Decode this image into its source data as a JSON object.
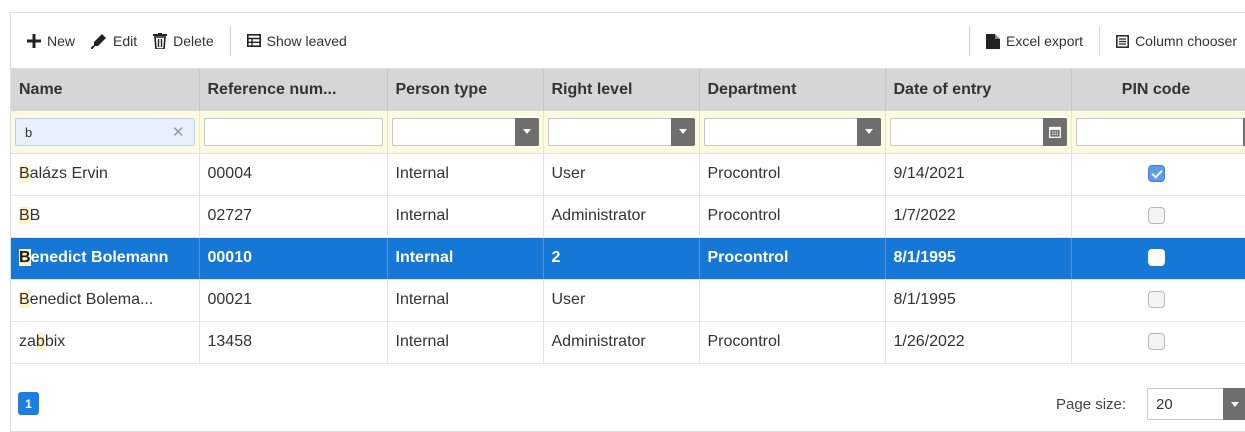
{
  "toolbar": {
    "new_label": "New",
    "edit_label": "Edit",
    "delete_label": "Delete",
    "show_leaved_label": "Show leaved",
    "excel_export_label": "Excel export",
    "column_chooser_label": "Column chooser"
  },
  "columns": [
    "Name",
    "Reference num...",
    "Person type",
    "Right level",
    "Department",
    "Date of entry",
    "PIN code"
  ],
  "filter": {
    "name_value": "b"
  },
  "rows": [
    {
      "name_pre": "",
      "name_hl": "B",
      "name_post": "alázs Ervin",
      "ref": "00004",
      "type": "Internal",
      "level": "User",
      "dept": "Procontrol",
      "date": "9/14/2021",
      "pin": true
    },
    {
      "name_pre": "",
      "name_hl": "B",
      "name_post": "B",
      "ref": "02727",
      "type": "Internal",
      "level": "Administrator",
      "dept": "Procontrol",
      "date": "1/7/2022",
      "pin": false
    },
    {
      "name_pre": "",
      "name_hl": "B",
      "name_post": "enedict Bolemann",
      "ref": "00010",
      "type": "Internal",
      "level": "2",
      "dept": "Procontrol",
      "date": "8/1/1995",
      "pin": false
    },
    {
      "name_pre": "",
      "name_hl": "B",
      "name_post": "enedict Bolema...",
      "ref": "00021",
      "type": "Internal",
      "level": "User",
      "dept": "",
      "date": "8/1/1995",
      "pin": false
    },
    {
      "name_pre": "za",
      "name_hl": "b",
      "name_post": "bix",
      "ref": "13458",
      "type": "Internal",
      "level": "Administrator",
      "dept": "Procontrol",
      "date": "1/26/2022",
      "pin": false
    }
  ],
  "pager": {
    "current_page": "1",
    "page_size_label": "Page size:",
    "page_size": "20"
  },
  "colors": {
    "header_bg": "#d6d6d6",
    "filter_bg": "#fbfbe2",
    "selected_row": "#1577d6",
    "accent": "#1a7ee3",
    "highlight": "#fff3c4"
  }
}
